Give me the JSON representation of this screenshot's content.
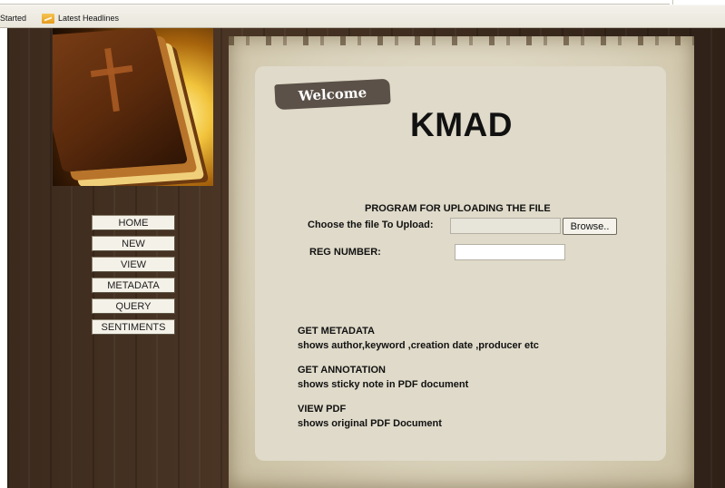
{
  "bookmarks": [
    {
      "label": "Started"
    },
    {
      "label": "Latest Headlines"
    }
  ],
  "header": {
    "welcome": "Welcome",
    "title": "KMAD"
  },
  "nav": {
    "items": [
      "HOME",
      "NEW",
      "VIEW",
      "METADATA",
      "QUERY",
      "SENTIMENTS"
    ]
  },
  "upload": {
    "heading": "PROGRAM FOR UPLOADING THE FILE",
    "choose_label": "Choose the file To Upload:",
    "file_value": "",
    "browse_label": "Browse..",
    "reg_label": "REG NUMBER:",
    "reg_value": ""
  },
  "info": [
    {
      "heading": "GET METADATA",
      "desc": "shows author,keyword ,creation date ,producer etc"
    },
    {
      "heading": "GET ANNOTATION",
      "desc": "shows sticky note in PDF document"
    },
    {
      "heading": "VIEW PDF",
      "desc": "shows original PDF Document"
    }
  ]
}
